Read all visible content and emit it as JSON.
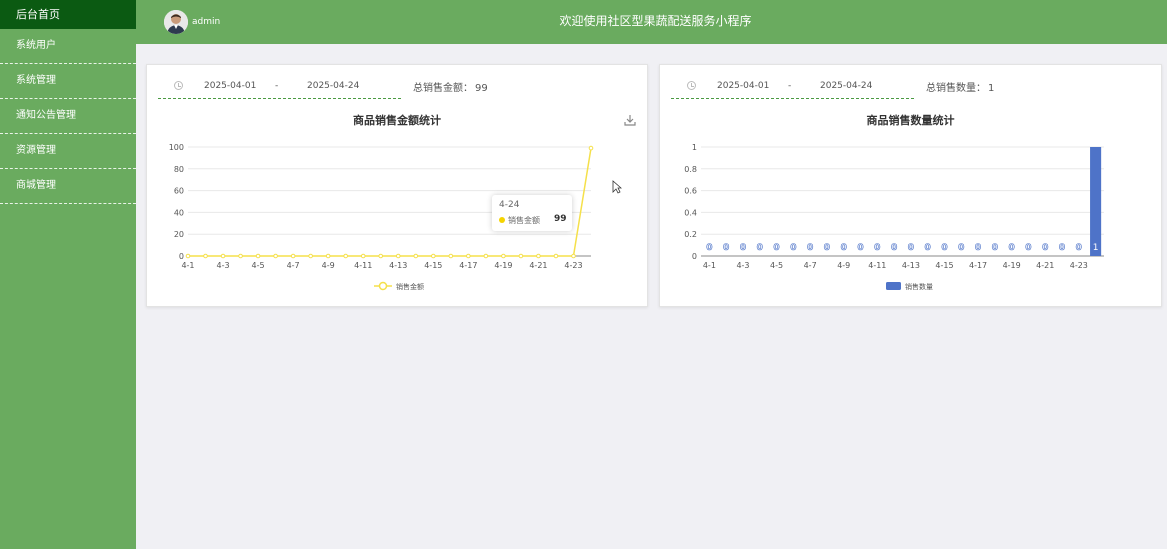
{
  "sidebar": {
    "home": "后台首页",
    "items": [
      "系统用户",
      "系统管理",
      "通知公告管理",
      "资源管理",
      "商城管理"
    ]
  },
  "header": {
    "username": "admin",
    "title": "欢迎使用社区型果蔬配送服务小程序"
  },
  "sales_amount": {
    "date_start": "2025-04-01",
    "date_sep": "-",
    "date_end": "2025-04-24",
    "total_label": "总销售金额：",
    "total_value": "99",
    "title": "商品销售金额统计",
    "tooltip": {
      "date": "4-24",
      "label": "销售金额",
      "value": "99"
    }
  },
  "sales_count": {
    "date_start": "2025-04-01",
    "date_sep": "-",
    "date_end": "2025-04-24",
    "total_label": "总销售数量：",
    "total_value": "1",
    "title": "商品销售数量统计"
  },
  "chart_data": [
    {
      "type": "line",
      "title": "商品销售金额统计",
      "categories": [
        "4-1",
        "4-2",
        "4-3",
        "4-4",
        "4-5",
        "4-6",
        "4-7",
        "4-8",
        "4-9",
        "4-10",
        "4-11",
        "4-12",
        "4-13",
        "4-14",
        "4-15",
        "4-16",
        "4-17",
        "4-18",
        "4-19",
        "4-20",
        "4-21",
        "4-22",
        "4-23",
        "4-24"
      ],
      "tick_labels": [
        "4-1",
        "4-3",
        "4-5",
        "4-7",
        "4-9",
        "4-11",
        "4-13",
        "4-15",
        "4-17",
        "4-19",
        "4-21",
        "4-23"
      ],
      "series": [
        {
          "name": "销售金额",
          "values": [
            0,
            0,
            0,
            0,
            0,
            0,
            0,
            0,
            0,
            0,
            0,
            0,
            0,
            0,
            0,
            0,
            0,
            0,
            0,
            0,
            0,
            0,
            0,
            99
          ]
        }
      ],
      "ylim": [
        0,
        100
      ],
      "yticks": [
        0,
        20,
        40,
        60,
        80,
        100
      ],
      "color": "#f5e04a",
      "legend": "bottom"
    },
    {
      "type": "bar",
      "title": "商品销售数量统计",
      "categories": [
        "4-1",
        "4-2",
        "4-3",
        "4-4",
        "4-5",
        "4-6",
        "4-7",
        "4-8",
        "4-9",
        "4-10",
        "4-11",
        "4-12",
        "4-13",
        "4-14",
        "4-15",
        "4-16",
        "4-17",
        "4-18",
        "4-19",
        "4-20",
        "4-21",
        "4-22",
        "4-23",
        "4-24"
      ],
      "tick_labels": [
        "4-1",
        "4-3",
        "4-5",
        "4-7",
        "4-9",
        "4-11",
        "4-13",
        "4-15",
        "4-17",
        "4-19",
        "4-21",
        "4-23"
      ],
      "series": [
        {
          "name": "销售数量",
          "values": [
            0,
            0,
            0,
            0,
            0,
            0,
            0,
            0,
            0,
            0,
            0,
            0,
            0,
            0,
            0,
            0,
            0,
            0,
            0,
            0,
            0,
            0,
            0,
            1
          ]
        }
      ],
      "ylim": [
        0,
        1
      ],
      "yticks": [
        0,
        0.2,
        0.4,
        0.6,
        0.8,
        1
      ],
      "color": "#4e73c8",
      "legend": "bottom"
    }
  ]
}
